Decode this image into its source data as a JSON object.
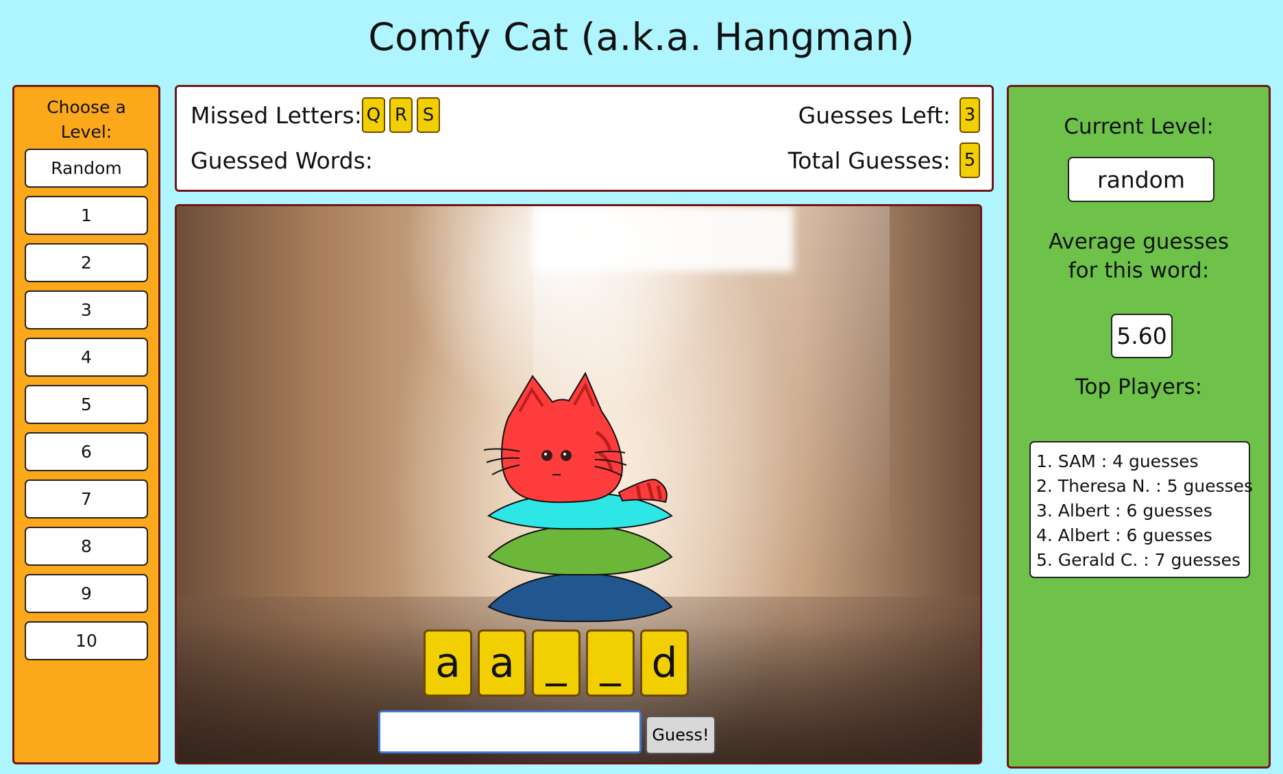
{
  "title": "Comfy Cat (a.k.a. Hangman)",
  "levels": {
    "heading_line1": "Choose a",
    "heading_line2": "Level:",
    "options": [
      "Random",
      "1",
      "2",
      "3",
      "4",
      "5",
      "6",
      "7",
      "8",
      "9",
      "10"
    ]
  },
  "stats": {
    "missed_label": "Missed Letters:",
    "missed_letters": [
      "Q",
      "R",
      "S"
    ],
    "guessed_words_label": "Guessed Words:",
    "guesses_left_label": "Guesses Left:",
    "guesses_left": "3",
    "total_guesses_label": "Total Guesses:",
    "total_guesses": "5"
  },
  "game": {
    "word_slots": [
      "a",
      "a",
      "_",
      "_",
      "d"
    ],
    "guess_input_value": "",
    "guess_button_label": "Guess!",
    "pillow_colors": [
      "#2ee6e6",
      "#6cb73a",
      "#22568f"
    ],
    "cat_color": "#ff3c3c"
  },
  "info": {
    "current_level_label": "Current Level:",
    "current_level": "random",
    "average_label_line1": "Average guesses",
    "average_label_line2": "for this word:",
    "average_value": "5.60",
    "top_players_label": "Top Players:",
    "top_players": [
      "1. SAM : 4 guesses",
      "2. Theresa N. : 5 guesses",
      "3. Albert : 6 guesses",
      "4. Albert : 6 guesses",
      "5. Gerald C. : 7 guesses"
    ]
  },
  "colors": {
    "background": "#aef5ff",
    "level_panel": "#fba81a",
    "info_panel": "#6ec24a",
    "tile": "#f2cf00",
    "border": "#6e1616"
  }
}
